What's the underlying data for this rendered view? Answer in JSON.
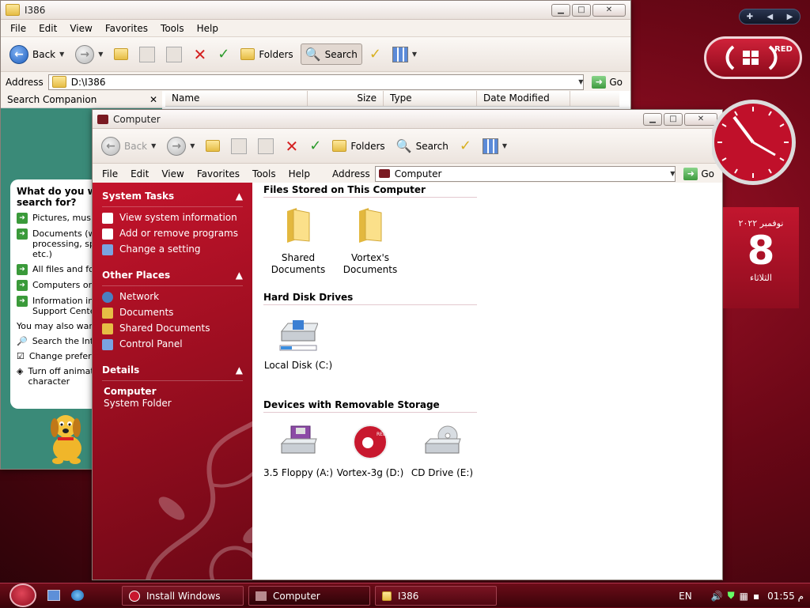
{
  "i386": {
    "title": "I386",
    "menu": [
      "File",
      "Edit",
      "View",
      "Favorites",
      "Tools",
      "Help"
    ],
    "toolbar": {
      "back": "Back",
      "folders": "Folders",
      "search": "Search"
    },
    "address_label": "Address",
    "address_value": "D:\\I386",
    "go": "Go",
    "companion_title": "Search Companion",
    "question": "What do you want to search for?",
    "options": [
      "Pictures, music, or video",
      "Documents (word processing, spreadsheet, etc.)",
      "All files and folders",
      "Computers or people",
      "Information in Help and Support Center"
    ],
    "also": "You may also want to...",
    "links": [
      "Search the Internet",
      "Change preferences",
      "Turn off animated character"
    ],
    "columns": [
      "Name",
      "Size",
      "Type",
      "Date Modified"
    ]
  },
  "computer": {
    "title": "Computer",
    "menu": [
      "File",
      "Edit",
      "View",
      "Favorites",
      "Tools",
      "Help"
    ],
    "toolbar": {
      "back": "Back",
      "folders": "Folders",
      "search": "Search"
    },
    "address_label": "Address",
    "address_value": "Computer",
    "go": "Go",
    "system_tasks": {
      "header": "System Tasks",
      "items": [
        "View system information",
        "Add or remove programs",
        "Change a setting"
      ]
    },
    "other_places": {
      "header": "Other Places",
      "items": [
        "Network",
        "Documents",
        "Shared Documents",
        "Control Panel"
      ]
    },
    "details": {
      "header": "Details",
      "name": "Computer",
      "type": "System Folder"
    },
    "groups": {
      "files": "Files Stored on This Computer",
      "hdd": "Hard Disk Drives",
      "removable": "Devices with Removable Storage"
    },
    "files_items": [
      "Shared Documents",
      "Vortex's Documents"
    ],
    "hdd_items": [
      "Local Disk (C:)"
    ],
    "removable_items": [
      "3.5 Floppy (A:)",
      "Vortex-3g (D:)",
      "CD Drive (E:)"
    ]
  },
  "gadgets": {
    "red_label": "RED",
    "calendar_month": "نوفمبر ٢٠٢٢",
    "calendar_day": "8",
    "calendar_weekday": "الثلاثاء"
  },
  "taskbar": {
    "buttons": [
      "Install Windows",
      "Computer",
      "I386"
    ],
    "lang": "EN",
    "time": "01:55 م"
  }
}
